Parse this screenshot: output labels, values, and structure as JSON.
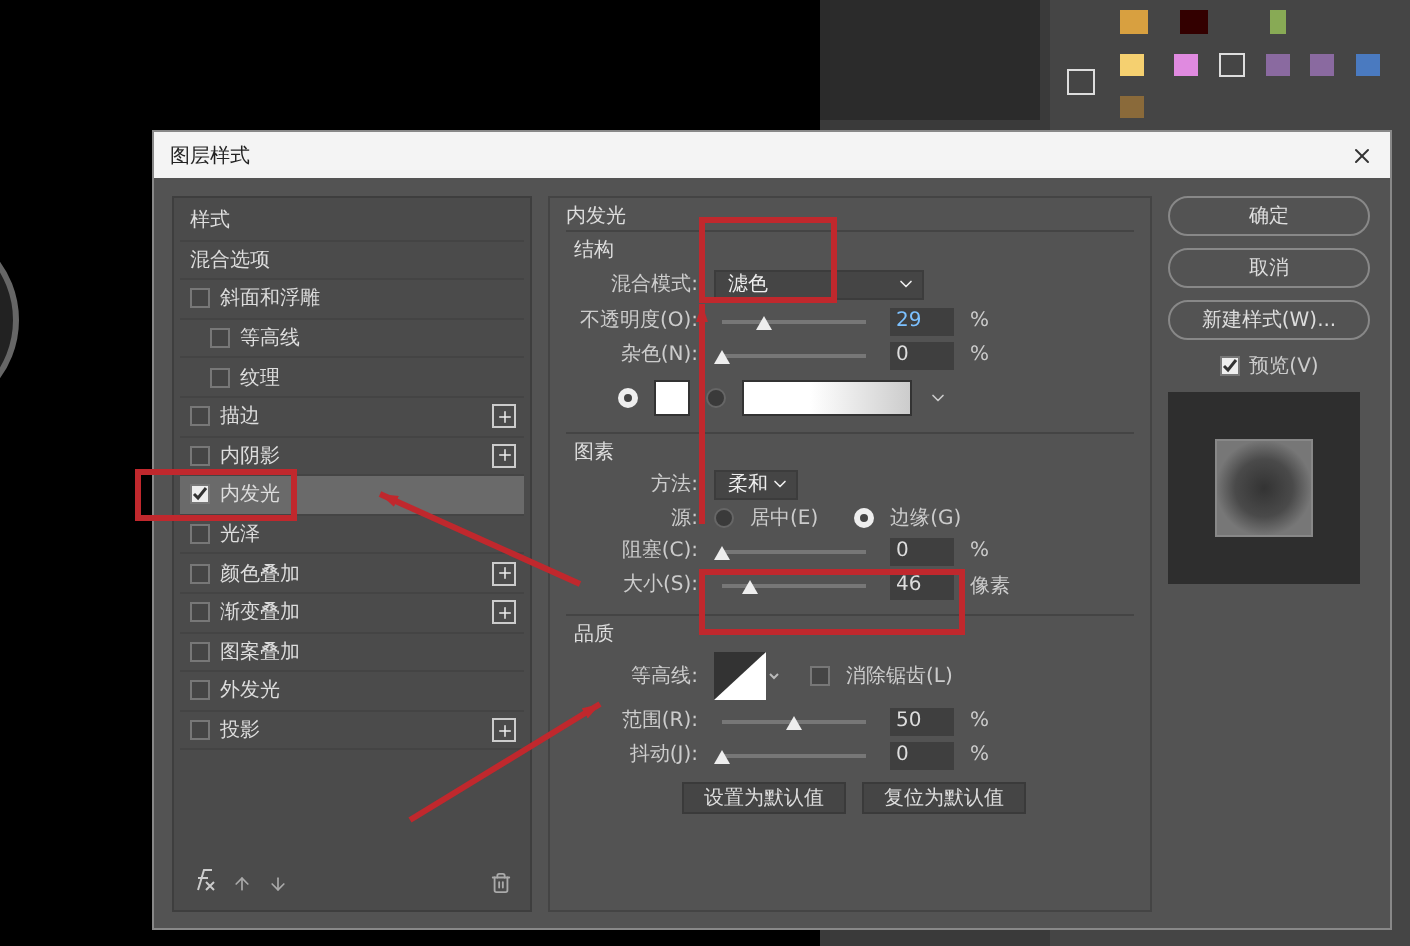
{
  "dialog": {
    "title": "图层样式"
  },
  "style_list": [
    {
      "label": "样式",
      "kind": "header",
      "selected": false
    },
    {
      "label": "混合选项",
      "kind": "header",
      "selected": false
    },
    {
      "label": "斜面和浮雕",
      "kind": "check",
      "checked": false,
      "selected": false,
      "add": false,
      "children": [
        {
          "label": "等高线",
          "kind": "check",
          "checked": false,
          "selected": false,
          "add": false
        },
        {
          "label": "纹理",
          "kind": "check",
          "checked": false,
          "selected": false,
          "add": false
        }
      ]
    },
    {
      "label": "描边",
      "kind": "check",
      "checked": false,
      "selected": false,
      "add": true
    },
    {
      "label": "内阴影",
      "kind": "check",
      "checked": false,
      "selected": false,
      "add": true
    },
    {
      "label": "内发光",
      "kind": "check",
      "checked": true,
      "selected": true,
      "add": false
    },
    {
      "label": "光泽",
      "kind": "check",
      "checked": false,
      "selected": false,
      "add": false
    },
    {
      "label": "颜色叠加",
      "kind": "check",
      "checked": false,
      "selected": false,
      "add": true
    },
    {
      "label": "渐变叠加",
      "kind": "check",
      "checked": false,
      "selected": false,
      "add": true
    },
    {
      "label": "图案叠加",
      "kind": "check",
      "checked": false,
      "selected": false,
      "add": false
    },
    {
      "label": "外发光",
      "kind": "check",
      "checked": false,
      "selected": false,
      "add": false
    },
    {
      "label": "投影",
      "kind": "check",
      "checked": false,
      "selected": false,
      "add": true
    }
  ],
  "settings": {
    "title": "内发光",
    "structure": {
      "heading": "结构",
      "blend_mode": {
        "label": "混合模式:",
        "value": "滤色"
      },
      "opacity": {
        "label": "不透明度(O):",
        "level": 0.29,
        "value": "29",
        "unit": "%",
        "highlighted": true
      },
      "noise": {
        "label": "杂色(N):",
        "level": 0,
        "value": "0",
        "unit": "%",
        "highlighted": false
      },
      "fill": [
        {
          "kind": "color",
          "selected": true
        },
        {
          "kind": "gradient",
          "selected": false
        }
      ]
    },
    "elements": {
      "heading": "图素",
      "technique": {
        "label": "方法:",
        "value": "柔和"
      },
      "source": {
        "label": "源:",
        "options": [
          {
            "label": "居中(E)",
            "selected": false
          },
          {
            "label": "边缘(G)",
            "selected": true
          }
        ]
      },
      "choke": {
        "label": "阻塞(C):",
        "level": 0,
        "value": "0",
        "unit": "%",
        "highlighted": false
      },
      "size": {
        "label": "大小(S):",
        "level": 0.2,
        "value": "46",
        "unit": "像素",
        "highlighted": false
      }
    },
    "quality": {
      "heading": "品质",
      "contour": {
        "label": "等高线:",
        "anti_alias": {
          "label": "消除锯齿(L)",
          "checked": false
        }
      },
      "range": {
        "label": "范围(R):",
        "level": 0.5,
        "value": "50",
        "unit": "%",
        "highlighted": false
      },
      "jitter": {
        "label": "抖动(J):",
        "level": 0,
        "value": "0",
        "unit": "%",
        "highlighted": false
      }
    },
    "buttons": [
      "设置为默认值",
      "复位为默认值"
    ]
  },
  "actions": [
    {
      "label": "确定"
    },
    {
      "label": "取消"
    },
    {
      "label": "新建样式(W)..."
    }
  ],
  "preview": {
    "label": "预览(V)",
    "checked": true
  }
}
